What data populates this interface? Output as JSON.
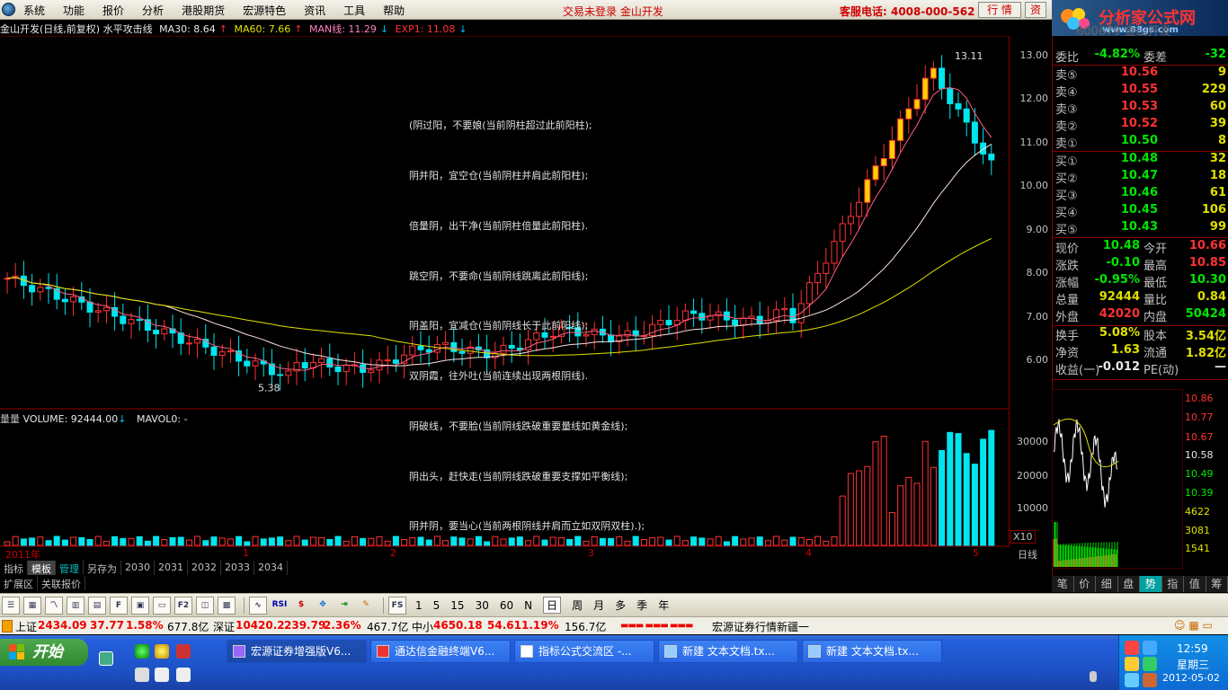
{
  "menu": {
    "items": [
      "系统",
      "功能",
      "报价",
      "分析",
      "港股期货",
      "宏源特色",
      "资讯",
      "工具",
      "帮助"
    ],
    "login_status": "交易未登录  金山开发",
    "hotline": "客服电话: 4008-000-562",
    "quote_btn": "行  情",
    "trade_btn": "资"
  },
  "brand": {
    "title": "分析家公式网",
    "url": "www.88gs.com"
  },
  "chart_header": {
    "stock": "金山开发(日线,前复权) 水平攻击线",
    "ma30": "MA30: 8.64",
    "ma60": "MA60: 7.66",
    "man": "MAN线: 11.29",
    "exp1": "EXP1: 11.08"
  },
  "notes": [
    "(阴过阳，不要娘(当前阴柱超过此前阳柱);",
    "阴并阳，宜空仓(当前阴柱并肩此前阳柱);",
    "倍量阴，出干净(当前阴柱倍量此前阳柱).",
    "跳空阴，不要命(当前阴线跳离此前阳线);",
    "阴盖阳，宜减仓(当前阴线长于此前阳线);",
    "双阴霞，往外吐(当前连续出现两根阴线).",
    "阴破线，不要脸(当前阴线跌破重要量线如黄金线);",
    "阴出头，赶快走(当前阴线跌破重要支撑如平衡线);",
    "阴并阴，要当心(当前两根阴线并肩而立如双阴双柱).);"
  ],
  "price_axis": [
    "13.00",
    "12.00",
    "11.00",
    "10.00",
    "9.00",
    "8.00",
    "7.00",
    "6.00"
  ],
  "price_labels": {
    "high": "13.11",
    "low": "5.38"
  },
  "volume": {
    "header_name": "量量",
    "header_value": "VOLUME: 92444.00",
    "header_ma": "MAVOL0: -",
    "axis": [
      "30000",
      "20000",
      "10000"
    ],
    "multiplier": "X10"
  },
  "time_axis": [
    "2011年",
    "1",
    "2",
    "3",
    "4",
    "5"
  ],
  "day_label": "日线",
  "tabs": [
    "指标",
    "模板",
    "管理",
    "另存为",
    "2030",
    "2031",
    "2032",
    "2033",
    "2034"
  ],
  "ext_tabs": [
    "扩展区",
    "关联报价"
  ],
  "quote": {
    "code_name": "600679 金山开发",
    "ratio_label": "委比",
    "ratio": "-4.82%",
    "diff_label": "委差",
    "diff": "-32",
    "asks": [
      {
        "label": "卖⑤",
        "price": "10.56",
        "vol": "9"
      },
      {
        "label": "卖④",
        "price": "10.55",
        "vol": "229"
      },
      {
        "label": "卖③",
        "price": "10.53",
        "vol": "60"
      },
      {
        "label": "卖②",
        "price": "10.52",
        "vol": "39"
      },
      {
        "label": "卖①",
        "price": "10.50",
        "vol": "8"
      }
    ],
    "bids": [
      {
        "label": "买①",
        "price": "10.48",
        "vol": "32"
      },
      {
        "label": "买②",
        "price": "10.47",
        "vol": "18"
      },
      {
        "label": "买③",
        "price": "10.46",
        "vol": "61"
      },
      {
        "label": "买④",
        "price": "10.45",
        "vol": "106"
      },
      {
        "label": "买⑤",
        "price": "10.43",
        "vol": "99"
      }
    ],
    "stats": [
      {
        "l1": "现价",
        "v1": "10.48",
        "c1": "down",
        "l2": "今开",
        "v2": "10.66",
        "c2": "up"
      },
      {
        "l1": "涨跌",
        "v1": "-0.10",
        "c1": "down",
        "l2": "最高",
        "v2": "10.85",
        "c2": "up"
      },
      {
        "l1": "涨幅",
        "v1": "-0.95%",
        "c1": "down",
        "l2": "最低",
        "v2": "10.30",
        "c2": "down"
      },
      {
        "l1": "总量",
        "v1": "92444",
        "c1": "yel",
        "l2": "量比",
        "v2": "0.84",
        "c2": "yel"
      },
      {
        "l1": "外盘",
        "v1": "42020",
        "c1": "up",
        "l2": "内盘",
        "v2": "50424",
        "c2": "down"
      },
      {
        "l1": "换手",
        "v1": "5.08%",
        "c1": "yel",
        "l2": "股本",
        "v2": "3.54亿",
        "c2": "yel"
      },
      {
        "l1": "净资",
        "v1": "1.63",
        "c1": "yel",
        "l2": "流通",
        "v2": "1.82亿",
        "c2": "yel"
      },
      {
        "l1": "收益(一)",
        "v1": "-0.012",
        "c1": "wht",
        "l2": "PE(动)",
        "v2": "—",
        "c2": "wht"
      }
    ]
  },
  "mini_axis": [
    "10.86",
    "10.77",
    "10.67",
    "10.58",
    "10.49",
    "10.39"
  ],
  "mini_vol_axis": [
    "4622",
    "3081",
    "1541"
  ],
  "right_tabs": [
    "笔",
    "价",
    "细",
    "盘",
    "势",
    "指",
    "值",
    "筹"
  ],
  "periods": [
    "1",
    "5",
    "15",
    "30",
    "60",
    "N",
    "日",
    "周",
    "月",
    "多",
    "季",
    "年"
  ],
  "status": {
    "sh_name": "上证",
    "sh_val": "2434.09",
    "sh_chg": "37.77",
    "sh_pct": "1.58%",
    "sh_amt": "677.8亿",
    "sz_name": "深证",
    "sz_val": "10420.2",
    "sz_chg": "239.79",
    "sz_pct": "2.36%",
    "sz_amt": "467.7亿",
    "zx_name": "中小",
    "zx_val": "4650.18",
    "zx_chg": "54.61",
    "zx_pct": "1.19%",
    "zx_amt": "156.7亿",
    "ticker": "宏源证券行情新疆一"
  },
  "taskbar": {
    "start": "开始",
    "tasks": [
      "宏源证券增强版V6...",
      "通达信金融终端V6...",
      "指标公式交流区 -...",
      "新建 文本文档.tx...",
      "新建 文本文档.tx..."
    ],
    "time": "12:59",
    "weekday": "星期三",
    "date": "2012-05-02"
  },
  "colors": {
    "up": "#ff3232",
    "down": "#00e600",
    "cyan": "#00c0c0",
    "yellow": "#e0e000",
    "gold": "#ffc000"
  }
}
